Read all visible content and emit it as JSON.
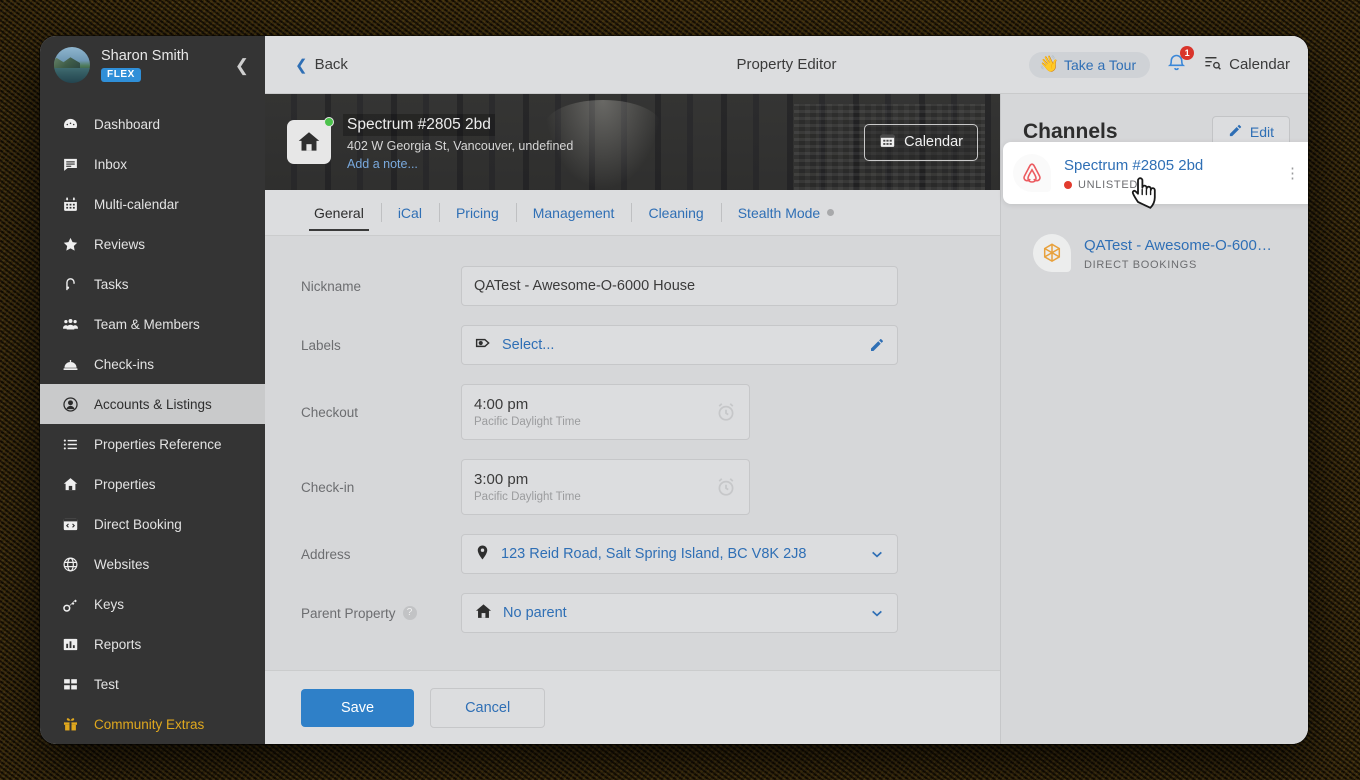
{
  "window": {
    "title": "Property Editor"
  },
  "sidebar": {
    "user": {
      "name": "Sharon Smith",
      "plan_badge": "FLEX"
    },
    "collapse_icon": "chevron-left-icon",
    "items": [
      {
        "label": "Dashboard",
        "icon": "dashboard-icon",
        "active": false
      },
      {
        "label": "Inbox",
        "icon": "inbox-icon",
        "active": false
      },
      {
        "label": "Multi-calendar",
        "icon": "calendar-icon",
        "active": false
      },
      {
        "label": "Reviews",
        "icon": "star-icon",
        "active": false
      },
      {
        "label": "Tasks",
        "icon": "tasks-icon",
        "active": false
      },
      {
        "label": "Team & Members",
        "icon": "users-icon",
        "active": false
      },
      {
        "label": "Check-ins",
        "icon": "bell-desk-icon",
        "active": false
      },
      {
        "label": "Accounts & Listings",
        "icon": "account-circle-icon",
        "active": true
      },
      {
        "label": "Properties Reference",
        "icon": "list-icon",
        "active": false
      },
      {
        "label": "Properties",
        "icon": "home-icon",
        "active": false
      },
      {
        "label": "Direct Booking",
        "icon": "code-window-icon",
        "active": false
      },
      {
        "label": "Websites",
        "icon": "globe-icon",
        "active": false
      },
      {
        "label": "Keys",
        "icon": "key-icon",
        "active": false
      },
      {
        "label": "Reports",
        "icon": "bar-chart-icon",
        "active": false
      },
      {
        "label": "Test",
        "icon": "grid-icon",
        "active": false
      },
      {
        "label": "Community Extras",
        "icon": "gift-icon",
        "active": false,
        "highlight": true
      }
    ]
  },
  "topbar": {
    "back_label": "Back",
    "title": "Property Editor",
    "tour_label": "Take a Tour",
    "tour_icon": "waving-hand-icon",
    "bell_icon": "notification-bell-icon",
    "bell_count": "1",
    "calendar_label": "Calendar",
    "calendar_icon": "calendar-list-icon"
  },
  "property_header": {
    "icon": "house-icon",
    "status_dot_color": "#4cc24c",
    "title": "Spectrum #2805 2bd",
    "address": "402 W Georgia St, Vancouver, undefined",
    "note_link": "Add a note...",
    "calendar_button": "Calendar",
    "calendar_icon": "calendar-icon"
  },
  "tabs": [
    {
      "label": "General",
      "active": true,
      "dot": false
    },
    {
      "label": "iCal",
      "active": false,
      "dot": false
    },
    {
      "label": "Pricing",
      "active": false,
      "dot": false
    },
    {
      "label": "Management",
      "active": false,
      "dot": false
    },
    {
      "label": "Cleaning",
      "active": false,
      "dot": false
    },
    {
      "label": "Stealth Mode",
      "active": false,
      "dot": true
    }
  ],
  "form": {
    "nickname": {
      "label": "Nickname",
      "value": "QATest - Awesome-O-6000 House"
    },
    "labels": {
      "label": "Labels",
      "value": "Select...",
      "icon": "tag-icon",
      "trailing_icon": "pencil-icon"
    },
    "checkout": {
      "label": "Checkout",
      "value": "4:00 pm",
      "timezone": "Pacific Daylight Time",
      "trailing_icon": "alarm-clock-icon"
    },
    "checkin": {
      "label": "Check-in",
      "value": "3:00 pm",
      "timezone": "Pacific Daylight Time",
      "trailing_icon": "alarm-clock-icon"
    },
    "address": {
      "label": "Address",
      "value": "123 Reid Road, Salt Spring Island, BC V8K 2J8",
      "icon": "map-pin-icon",
      "trailing_icon": "chevron-down-icon"
    },
    "parent_property": {
      "label": "Parent Property",
      "help": "?",
      "value": "No parent",
      "icon": "house-icon",
      "trailing_icon": "chevron-down-icon"
    }
  },
  "footer": {
    "save_label": "Save",
    "cancel_label": "Cancel"
  },
  "channels": {
    "title": "Channels",
    "edit_label": "Edit",
    "edit_icon": "pencil-icon",
    "items": [
      {
        "name": "Spectrum #2805 2bd",
        "status": "UNLISTED",
        "status_color": "#e23b2e",
        "logo": "airbnb-icon",
        "hovered": true,
        "kebab_icon": "more-vertical-icon"
      },
      {
        "name": "QATest - Awesome-O-6000 H...",
        "status": "DIRECT BOOKINGS",
        "status_color": "#6c6d70",
        "logo": "direct-booking-icon",
        "hovered": false,
        "kebab_icon": "more-vertical-icon"
      }
    ]
  },
  "colors": {
    "accent_blue": "#2f6fb5",
    "primary_button": "#2f80c8",
    "sidebar_bg": "#343434",
    "panel_bg": "#d6d7d9",
    "gold": "#e0a81e",
    "status_red": "#e23b2e",
    "status_green": "#4cc24c"
  }
}
